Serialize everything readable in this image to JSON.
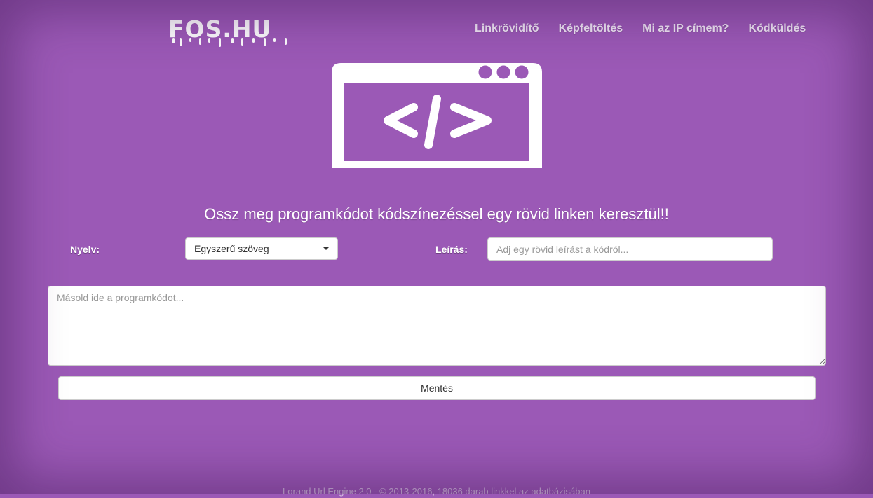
{
  "brand": {
    "logo_text": "FOS.HU"
  },
  "nav": {
    "items": [
      {
        "label": "Linkrövidítő"
      },
      {
        "label": "Képfeltöltés"
      },
      {
        "label": "Mi az IP címem?"
      },
      {
        "label": "Kódküldés"
      }
    ]
  },
  "hero": {
    "icon": "code-window-icon"
  },
  "headline": "Ossz meg programkódot kódszínezéssel egy rövid linken keresztül!!",
  "form": {
    "language_label": "Nyelv:",
    "language_selected": "Egyszerű szöveg",
    "description_label": "Leírás:",
    "description_placeholder": "Adj egy rövid leírást a kódról...",
    "code_placeholder": "Másold ide a programkódot...",
    "save_label": "Mentés"
  },
  "footer": {
    "text": "Lorand Url Engine 2.0 - © 2013-2016, 18036 darab linkkel az adatbázisában"
  },
  "colors": {
    "background": "#9b59b6",
    "text_light": "#ffffff"
  }
}
